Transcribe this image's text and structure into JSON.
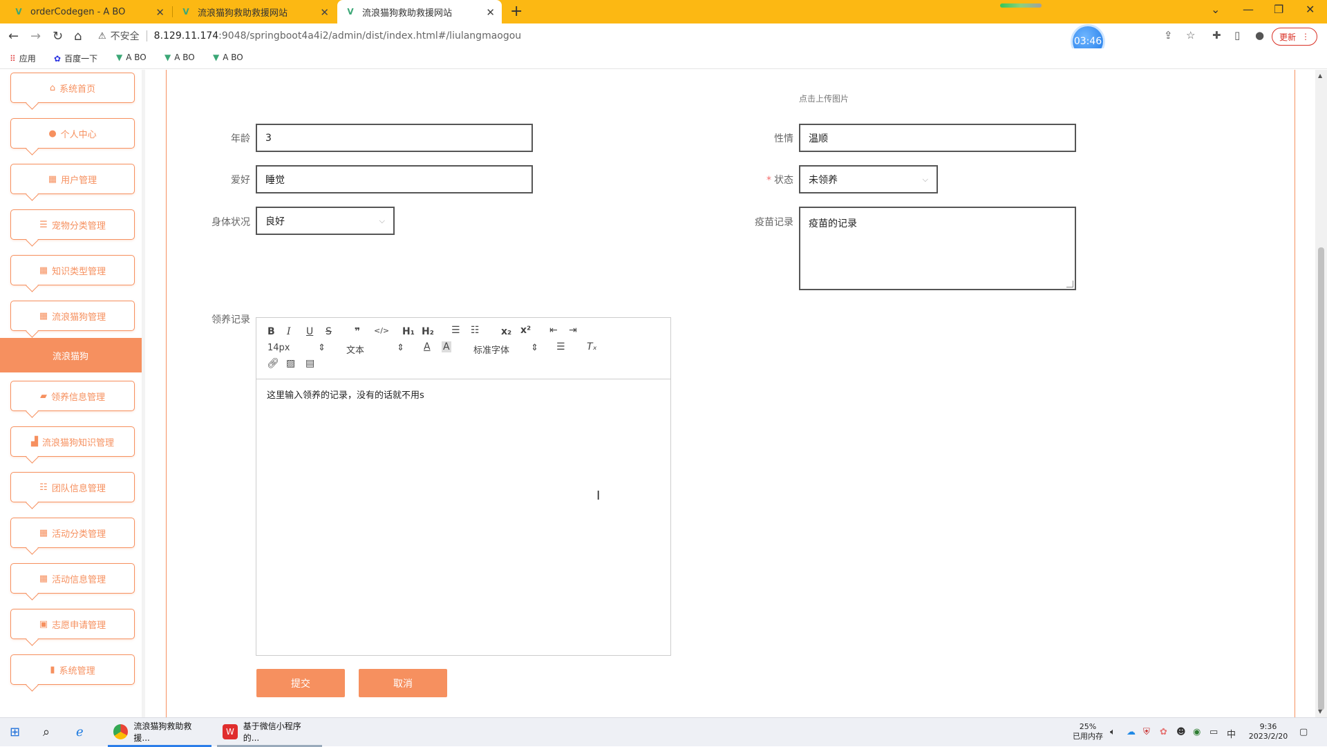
{
  "browser": {
    "tabs": [
      {
        "title": "orderCodegen - A BO"
      },
      {
        "title": "流浪猫狗救助救援网站"
      },
      {
        "title": "流浪猫狗救助救援网站"
      }
    ],
    "new_tab": "+",
    "address": {
      "insecure_label": "不安全",
      "host": "8.129.11.174",
      "path": ":9048/springboot4a4i2/admin/dist/index.html#/liulangmaogou"
    },
    "timer": "03:46",
    "update_label": "更新",
    "bookmarks": [
      {
        "label": "应用"
      },
      {
        "label": "百度一下"
      },
      {
        "label": "A BO"
      },
      {
        "label": "A BO"
      },
      {
        "label": "A BO"
      }
    ]
  },
  "sidebar": {
    "items": [
      {
        "label": "系统首页",
        "icon": "home-icon"
      },
      {
        "label": "个人中心",
        "icon": "user-icon"
      },
      {
        "label": "用户管理",
        "icon": "grid-icon"
      },
      {
        "label": "宠物分类管理",
        "icon": "list-icon"
      },
      {
        "label": "知识类型管理",
        "icon": "grid-icon"
      },
      {
        "label": "流浪猫狗管理",
        "icon": "grid-icon"
      },
      {
        "label": "领养信息管理",
        "icon": "ticket-icon"
      },
      {
        "label": "流浪猫狗知识管理",
        "icon": "book-icon"
      },
      {
        "label": "团队信息管理",
        "icon": "sliders-icon"
      },
      {
        "label": "活动分类管理",
        "icon": "grid-icon"
      },
      {
        "label": "活动信息管理",
        "icon": "grid-icon"
      },
      {
        "label": "志愿申请管理",
        "icon": "clipboard-icon"
      },
      {
        "label": "系统管理",
        "icon": "bar-chart-icon"
      }
    ],
    "active_sub": "流浪猫狗"
  },
  "form": {
    "upload_hint": "点击上传图片",
    "age": {
      "label": "年龄",
      "value": "3"
    },
    "temperament": {
      "label": "性情",
      "value": "温顺"
    },
    "hobby": {
      "label": "爱好",
      "value": "睡觉"
    },
    "status": {
      "label": "状态",
      "required": "*",
      "value": "未领养"
    },
    "health": {
      "label": "身体状况",
      "value": "良好"
    },
    "vaccine": {
      "label": "疫苗记录",
      "value": "疫苗的记录"
    },
    "adoption": {
      "label": "领养记录",
      "toolbar": {
        "font_size": "14px",
        "text_style": "文本",
        "font_family": "标准字体"
      },
      "content": "这里输入领养的记录，没有的话就不用s"
    },
    "submit_label": "提交",
    "cancel_label": "取消"
  },
  "taskbar": {
    "apps": [
      {
        "label": "流浪猫狗救助救援..."
      },
      {
        "label": "基于微信小程序的..."
      }
    ],
    "memory_percent": "25%",
    "memory_label": "已用内存",
    "ime": "中",
    "time": "9:36",
    "date": "2023/2/20"
  },
  "colors": {
    "accent": "#f6905f",
    "tab_bar": "#fcb813"
  }
}
